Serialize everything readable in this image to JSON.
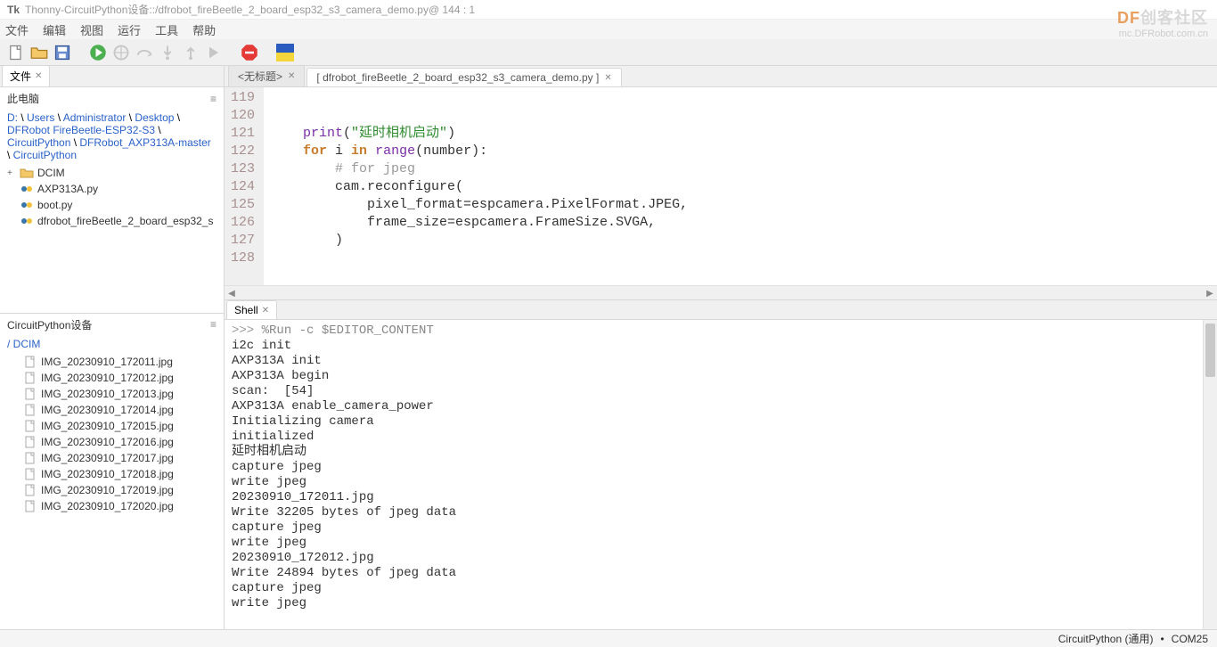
{
  "title_bar": {
    "app": "Thonny",
    "sep1": "  -  ",
    "device": "CircuitPython设备",
    "sep2": " :: ",
    "path": "/dfrobot_fireBeetle_2_board_esp32_s3_camera_demo.py",
    "pos": "  @  144 : 1"
  },
  "menus": [
    "文件",
    "编辑",
    "视图",
    "运行",
    "工具",
    "帮助"
  ],
  "left": {
    "files_tab": "文件",
    "this_pc": "此电脑",
    "path_parts": [
      "D:",
      "Users",
      "Administrator",
      "Desktop",
      "DFRobot FireBeetle-ESP32-S3",
      "CircuitPython",
      "DFRobot_AXP313A-master",
      "CircuitPython"
    ],
    "tree": [
      {
        "type": "folder",
        "name": "DCIM",
        "expander": "+"
      },
      {
        "type": "py",
        "name": "AXP313A.py"
      },
      {
        "type": "py",
        "name": "boot.py"
      },
      {
        "type": "py",
        "name": "dfrobot_fireBeetle_2_board_esp32_s"
      }
    ],
    "device_title": "CircuitPython设备",
    "device_path": "/ DCIM",
    "device_files": [
      "IMG_20230910_172011.jpg",
      "IMG_20230910_172012.jpg",
      "IMG_20230910_172013.jpg",
      "IMG_20230910_172014.jpg",
      "IMG_20230910_172015.jpg",
      "IMG_20230910_172016.jpg",
      "IMG_20230910_172017.jpg",
      "IMG_20230910_172018.jpg",
      "IMG_20230910_172019.jpg",
      "IMG_20230910_172020.jpg"
    ]
  },
  "editor": {
    "tab1": "<无标题>",
    "tab2": "[ dfrobot_fireBeetle_2_board_esp32_s3_camera_demo.py ]",
    "lines": {
      "start": 119,
      "count": 10
    }
  },
  "shell": {
    "tab": "Shell",
    "prompt": ">>> ",
    "cmd": "%Run -c $EDITOR_CONTENT",
    "output": [
      "i2c init",
      "AXP313A init",
      "AXP313A begin",
      "scan:  [54]",
      "AXP313A enable_camera_power",
      "Initializing camera",
      "initialized",
      "延时相机启动",
      "capture jpeg",
      "write jpeg",
      "20230910_172011.jpg",
      "Write 32205 bytes of jpeg data",
      "capture jpeg",
      "write jpeg",
      "20230910_172012.jpg",
      "Write 24894 bytes of jpeg data",
      "capture jpeg",
      "write jpeg"
    ]
  },
  "status": {
    "backend": "CircuitPython (通用)",
    "dot": "•",
    "port": "COM25"
  },
  "watermark": {
    "l1a": "DF",
    "l1b": "创客社区",
    "l2": "mc.DFRobot.com.cn"
  }
}
